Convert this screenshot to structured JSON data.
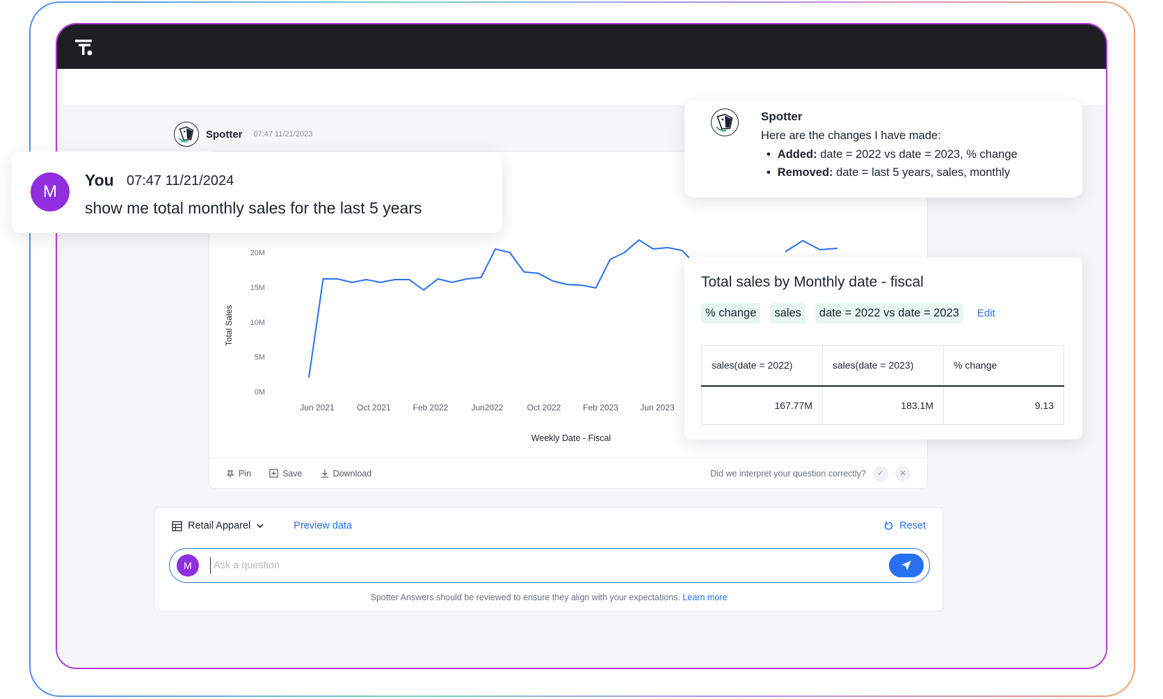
{
  "spotter": {
    "name": "Spotter",
    "timestamp": "07:47 11/21/2023"
  },
  "user_message": {
    "avatar": "M",
    "name": "You",
    "timestamp": "07:47 11/21/2024",
    "text": "show me total monthly sales for the last 5 years"
  },
  "changes": {
    "name": "Spotter",
    "intro": "Here are the changes I have made:",
    "added_label": "Added:",
    "added_text": "date = 2022 vs date = 2023, % change",
    "removed_label": "Removed:",
    "removed_text": "date = last 5 years, sales, monthly"
  },
  "answer_table": {
    "title": "Total sales by Monthly date - fiscal",
    "chips": [
      "% change",
      "sales",
      "date = 2022 vs date = 2023"
    ],
    "edit_label": "Edit",
    "headers": [
      "sales(date = 2022)",
      "sales(date = 2023)",
      "% change"
    ],
    "rows": [
      [
        "167.77M",
        "183.1M",
        "9.13"
      ]
    ]
  },
  "chart_data": {
    "type": "line",
    "xlabel": "Weekly Date - Fiscal",
    "ylabel": "Total Sales",
    "x_tick_labels": [
      "Jun 2021",
      "Oct 2021",
      "Feb 2022",
      "Jun2022",
      "Oct 2022",
      "Feb 2023",
      "Jun 2023"
    ],
    "y_tick_labels": [
      "0M",
      "5M",
      "10M",
      "15M",
      "20M"
    ],
    "ylim": [
      0,
      20
    ],
    "y_unit": "M",
    "series": [
      {
        "color": "#2770ef",
        "values": [
          2,
          16.2,
          16.2,
          15.7,
          16.1,
          15.7,
          16.1,
          16.1,
          14.6,
          16.2,
          15.7,
          16.2,
          16.4,
          20.5,
          20.0,
          17.2,
          17.0,
          15.9,
          15.4,
          15.3,
          14.9,
          19.0,
          20.0,
          21.8,
          20.5,
          20.7,
          20.3,
          18.2
        ],
        "hidden_tail_values": [
          20.1,
          21.7,
          20.4,
          20.6
        ]
      }
    ]
  },
  "chart_actions": {
    "pin": "Pin",
    "save": "Save",
    "download": "Download",
    "feedback_question": "Did we interpret your question correctly?"
  },
  "query": {
    "datasource": "Retail Apparel",
    "preview_label": "Preview data",
    "reset_label": "Reset",
    "avatar": "M",
    "placeholder": "Ask a question",
    "disclaimer": "Spotter Answers should be reviewed to ensure they align with your expectations.",
    "learn_more": "Learn more"
  },
  "colors": {
    "accent": "#2770ef",
    "avatar": "#8f2fe0",
    "chip_bg": "#e7f6f0",
    "frame": "#b03ad6"
  },
  "icons": [
    "app-logo-icon",
    "spotter-dog-icon",
    "pin-icon",
    "save-icon",
    "download-icon",
    "check-icon",
    "close-icon",
    "table-icon",
    "chevron-down-icon",
    "reset-icon",
    "send-icon"
  ]
}
